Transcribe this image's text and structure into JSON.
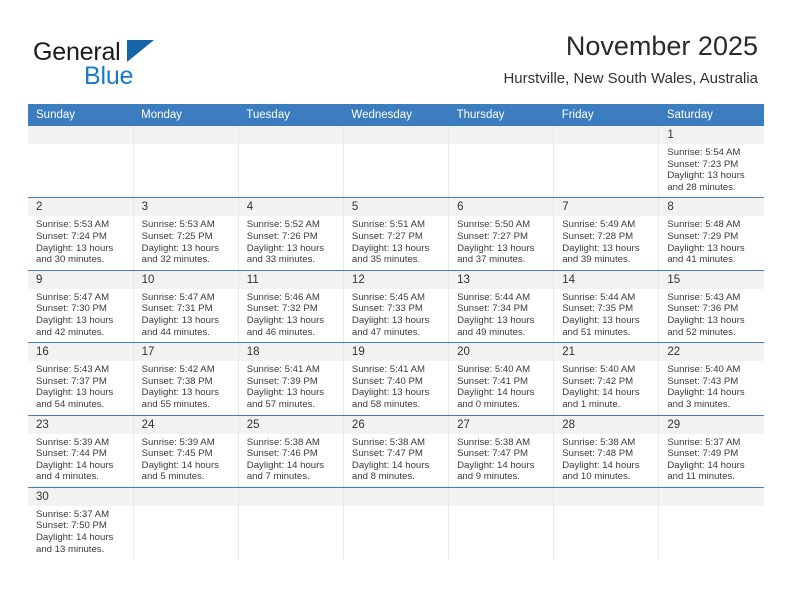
{
  "brand": {
    "name_top": "General",
    "name_bottom": "Blue",
    "triangle_color": "#1565a8",
    "blue_text_color": "#1879c7"
  },
  "header": {
    "title": "November 2025",
    "subtitle": "Hurstville, New South Wales, Australia"
  },
  "theme": {
    "header_blue": "#3c7dbf",
    "daynum_band": "#f2f2f2",
    "text": "#333333"
  },
  "weekdays": [
    "Sunday",
    "Monday",
    "Tuesday",
    "Wednesday",
    "Thursday",
    "Friday",
    "Saturday"
  ],
  "labels": {
    "sunrise_prefix": "Sunrise:",
    "sunset_prefix": "Sunset:",
    "daylight_prefix": "Daylight:"
  },
  "weeks": [
    [
      {
        "day": "",
        "sunrise": "",
        "sunset": "",
        "daylight": ""
      },
      {
        "day": "",
        "sunrise": "",
        "sunset": "",
        "daylight": ""
      },
      {
        "day": "",
        "sunrise": "",
        "sunset": "",
        "daylight": ""
      },
      {
        "day": "",
        "sunrise": "",
        "sunset": "",
        "daylight": ""
      },
      {
        "day": "",
        "sunrise": "",
        "sunset": "",
        "daylight": ""
      },
      {
        "day": "",
        "sunrise": "",
        "sunset": "",
        "daylight": ""
      },
      {
        "day": "1",
        "sunrise": "Sunrise: 5:54 AM",
        "sunset": "Sunset: 7:23 PM",
        "daylight": "Daylight: 13 hours and 28 minutes."
      }
    ],
    [
      {
        "day": "2",
        "sunrise": "Sunrise: 5:53 AM",
        "sunset": "Sunset: 7:24 PM",
        "daylight": "Daylight: 13 hours and 30 minutes."
      },
      {
        "day": "3",
        "sunrise": "Sunrise: 5:53 AM",
        "sunset": "Sunset: 7:25 PM",
        "daylight": "Daylight: 13 hours and 32 minutes."
      },
      {
        "day": "4",
        "sunrise": "Sunrise: 5:52 AM",
        "sunset": "Sunset: 7:26 PM",
        "daylight": "Daylight: 13 hours and 33 minutes."
      },
      {
        "day": "5",
        "sunrise": "Sunrise: 5:51 AM",
        "sunset": "Sunset: 7:27 PM",
        "daylight": "Daylight: 13 hours and 35 minutes."
      },
      {
        "day": "6",
        "sunrise": "Sunrise: 5:50 AM",
        "sunset": "Sunset: 7:27 PM",
        "daylight": "Daylight: 13 hours and 37 minutes."
      },
      {
        "day": "7",
        "sunrise": "Sunrise: 5:49 AM",
        "sunset": "Sunset: 7:28 PM",
        "daylight": "Daylight: 13 hours and 39 minutes."
      },
      {
        "day": "8",
        "sunrise": "Sunrise: 5:48 AM",
        "sunset": "Sunset: 7:29 PM",
        "daylight": "Daylight: 13 hours and 41 minutes."
      }
    ],
    [
      {
        "day": "9",
        "sunrise": "Sunrise: 5:47 AM",
        "sunset": "Sunset: 7:30 PM",
        "daylight": "Daylight: 13 hours and 42 minutes."
      },
      {
        "day": "10",
        "sunrise": "Sunrise: 5:47 AM",
        "sunset": "Sunset: 7:31 PM",
        "daylight": "Daylight: 13 hours and 44 minutes."
      },
      {
        "day": "11",
        "sunrise": "Sunrise: 5:46 AM",
        "sunset": "Sunset: 7:32 PM",
        "daylight": "Daylight: 13 hours and 46 minutes."
      },
      {
        "day": "12",
        "sunrise": "Sunrise: 5:45 AM",
        "sunset": "Sunset: 7:33 PM",
        "daylight": "Daylight: 13 hours and 47 minutes."
      },
      {
        "day": "13",
        "sunrise": "Sunrise: 5:44 AM",
        "sunset": "Sunset: 7:34 PM",
        "daylight": "Daylight: 13 hours and 49 minutes."
      },
      {
        "day": "14",
        "sunrise": "Sunrise: 5:44 AM",
        "sunset": "Sunset: 7:35 PM",
        "daylight": "Daylight: 13 hours and 51 minutes."
      },
      {
        "day": "15",
        "sunrise": "Sunrise: 5:43 AM",
        "sunset": "Sunset: 7:36 PM",
        "daylight": "Daylight: 13 hours and 52 minutes."
      }
    ],
    [
      {
        "day": "16",
        "sunrise": "Sunrise: 5:43 AM",
        "sunset": "Sunset: 7:37 PM",
        "daylight": "Daylight: 13 hours and 54 minutes."
      },
      {
        "day": "17",
        "sunrise": "Sunrise: 5:42 AM",
        "sunset": "Sunset: 7:38 PM",
        "daylight": "Daylight: 13 hours and 55 minutes."
      },
      {
        "day": "18",
        "sunrise": "Sunrise: 5:41 AM",
        "sunset": "Sunset: 7:39 PM",
        "daylight": "Daylight: 13 hours and 57 minutes."
      },
      {
        "day": "19",
        "sunrise": "Sunrise: 5:41 AM",
        "sunset": "Sunset: 7:40 PM",
        "daylight": "Daylight: 13 hours and 58 minutes."
      },
      {
        "day": "20",
        "sunrise": "Sunrise: 5:40 AM",
        "sunset": "Sunset: 7:41 PM",
        "daylight": "Daylight: 14 hours and 0 minutes."
      },
      {
        "day": "21",
        "sunrise": "Sunrise: 5:40 AM",
        "sunset": "Sunset: 7:42 PM",
        "daylight": "Daylight: 14 hours and 1 minute."
      },
      {
        "day": "22",
        "sunrise": "Sunrise: 5:40 AM",
        "sunset": "Sunset: 7:43 PM",
        "daylight": "Daylight: 14 hours and 3 minutes."
      }
    ],
    [
      {
        "day": "23",
        "sunrise": "Sunrise: 5:39 AM",
        "sunset": "Sunset: 7:44 PM",
        "daylight": "Daylight: 14 hours and 4 minutes."
      },
      {
        "day": "24",
        "sunrise": "Sunrise: 5:39 AM",
        "sunset": "Sunset: 7:45 PM",
        "daylight": "Daylight: 14 hours and 5 minutes."
      },
      {
        "day": "25",
        "sunrise": "Sunrise: 5:38 AM",
        "sunset": "Sunset: 7:46 PM",
        "daylight": "Daylight: 14 hours and 7 minutes."
      },
      {
        "day": "26",
        "sunrise": "Sunrise: 5:38 AM",
        "sunset": "Sunset: 7:47 PM",
        "daylight": "Daylight: 14 hours and 8 minutes."
      },
      {
        "day": "27",
        "sunrise": "Sunrise: 5:38 AM",
        "sunset": "Sunset: 7:47 PM",
        "daylight": "Daylight: 14 hours and 9 minutes."
      },
      {
        "day": "28",
        "sunrise": "Sunrise: 5:38 AM",
        "sunset": "Sunset: 7:48 PM",
        "daylight": "Daylight: 14 hours and 10 minutes."
      },
      {
        "day": "29",
        "sunrise": "Sunrise: 5:37 AM",
        "sunset": "Sunset: 7:49 PM",
        "daylight": "Daylight: 14 hours and 11 minutes."
      }
    ],
    [
      {
        "day": "30",
        "sunrise": "Sunrise: 5:37 AM",
        "sunset": "Sunset: 7:50 PM",
        "daylight": "Daylight: 14 hours and 13 minutes."
      },
      {
        "day": "",
        "sunrise": "",
        "sunset": "",
        "daylight": ""
      },
      {
        "day": "",
        "sunrise": "",
        "sunset": "",
        "daylight": ""
      },
      {
        "day": "",
        "sunrise": "",
        "sunset": "",
        "daylight": ""
      },
      {
        "day": "",
        "sunrise": "",
        "sunset": "",
        "daylight": ""
      },
      {
        "day": "",
        "sunrise": "",
        "sunset": "",
        "daylight": ""
      },
      {
        "day": "",
        "sunrise": "",
        "sunset": "",
        "daylight": ""
      }
    ]
  ]
}
